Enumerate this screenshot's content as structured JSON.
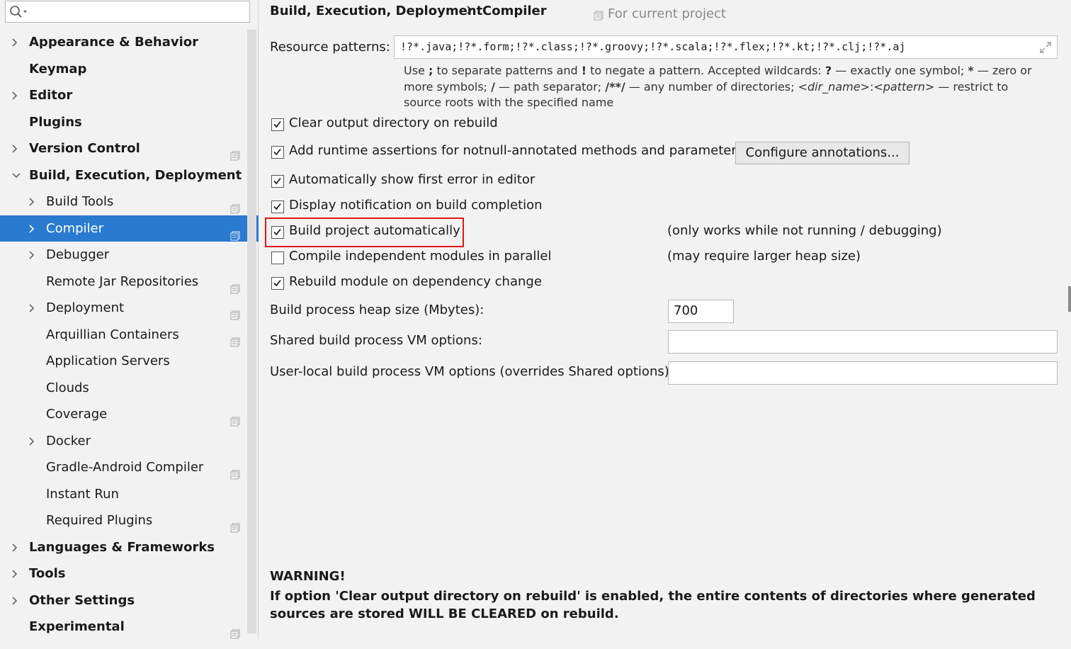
{
  "search": {
    "placeholder": ""
  },
  "sidebar": {
    "items": [
      {
        "label": "Appearance & Behavior",
        "level": 0,
        "expandable": true,
        "expanded": false,
        "project_icon": false
      },
      {
        "label": "Keymap",
        "level": 0,
        "expandable": false,
        "project_icon": false
      },
      {
        "label": "Editor",
        "level": 0,
        "expandable": true,
        "expanded": false,
        "project_icon": false
      },
      {
        "label": "Plugins",
        "level": 0,
        "expandable": false,
        "project_icon": false
      },
      {
        "label": "Version Control",
        "level": 0,
        "expandable": true,
        "expanded": false,
        "project_icon": true
      },
      {
        "label": "Build, Execution, Deployment",
        "level": 0,
        "expandable": true,
        "expanded": true,
        "project_icon": false
      },
      {
        "label": "Build Tools",
        "level": 1,
        "expandable": true,
        "expanded": false,
        "project_icon": true
      },
      {
        "label": "Compiler",
        "level": 1,
        "expandable": true,
        "expanded": false,
        "project_icon": true,
        "selected": true
      },
      {
        "label": "Debugger",
        "level": 1,
        "expandable": true,
        "expanded": false,
        "project_icon": false
      },
      {
        "label": "Remote Jar Repositories",
        "level": 1,
        "expandable": false,
        "project_icon": true
      },
      {
        "label": "Deployment",
        "level": 1,
        "expandable": true,
        "expanded": false,
        "project_icon": true
      },
      {
        "label": "Arquillian Containers",
        "level": 1,
        "expandable": false,
        "project_icon": true
      },
      {
        "label": "Application Servers",
        "level": 1,
        "expandable": false,
        "project_icon": false
      },
      {
        "label": "Clouds",
        "level": 1,
        "expandable": false,
        "project_icon": false
      },
      {
        "label": "Coverage",
        "level": 1,
        "expandable": false,
        "project_icon": true
      },
      {
        "label": "Docker",
        "level": 1,
        "expandable": true,
        "expanded": false,
        "project_icon": false
      },
      {
        "label": "Gradle-Android Compiler",
        "level": 1,
        "expandable": false,
        "project_icon": true
      },
      {
        "label": "Instant Run",
        "level": 1,
        "expandable": false,
        "project_icon": false
      },
      {
        "label": "Required Plugins",
        "level": 1,
        "expandable": false,
        "project_icon": true
      },
      {
        "label": "Languages & Frameworks",
        "level": 0,
        "expandable": true,
        "expanded": false,
        "project_icon": false
      },
      {
        "label": "Tools",
        "level": 0,
        "expandable": true,
        "expanded": false,
        "project_icon": false
      },
      {
        "label": "Other Settings",
        "level": 0,
        "expandable": true,
        "expanded": false,
        "project_icon": false
      },
      {
        "label": "Experimental",
        "level": 0,
        "expandable": false,
        "project_icon": true
      }
    ]
  },
  "header": {
    "crumb1": "Build, Execution, Deployment",
    "crumb2": "Compiler",
    "for_project": "For current project"
  },
  "resource": {
    "label": "Resource patterns:",
    "value": "!?*.java;!?*.form;!?*.class;!?*.groovy;!?*.scala;!?*.flex;!?*.kt;!?*.clj;!?*.aj",
    "hint": {
      "t1": "Use ",
      "b1": ";",
      "t2": " to separate patterns and ",
      "b2": "!",
      "t3": " to negate a pattern. Accepted wildcards: ",
      "b3": "?",
      "t4": " — exactly one symbol; ",
      "b4": "*",
      "t5": " — zero or more symbols; ",
      "b5": "/",
      "t6": " — path separator; ",
      "b6": "/**/",
      "t7": " — any number of directories; ",
      "i1": "<dir_name>",
      "t8": ":",
      "i2": "<pattern>",
      "t9": " — restrict to source roots with the specified name"
    }
  },
  "options": {
    "clear_output": {
      "label": "Clear output directory on rebuild",
      "checked": true
    },
    "runtime_assertions": {
      "label": "Add runtime assertions for notnull-annotated methods and parameters",
      "checked": true
    },
    "configure_button": "Configure annotations...",
    "show_first_error": {
      "label": "Automatically show first error in editor",
      "checked": true
    },
    "display_notification": {
      "label": "Display notification on build completion",
      "checked": true
    },
    "build_auto": {
      "label": "Build project automatically",
      "checked": true,
      "note": "(only works while not running / debugging)"
    },
    "compile_parallel": {
      "label": "Compile independent modules in parallel",
      "checked": false,
      "note": "(may require larger heap size)"
    },
    "rebuild_on_dep": {
      "label": "Rebuild module on dependency change",
      "checked": true
    }
  },
  "heap": {
    "label": "Build process heap size (Mbytes):",
    "value": "700"
  },
  "shared_vm": {
    "label": "Shared build process VM options:",
    "value": ""
  },
  "user_vm": {
    "label": "User-local build process VM options (overrides Shared options):",
    "value": ""
  },
  "warning": {
    "title": "WARNING!",
    "text": "If option 'Clear output directory on rebuild' is enabled, the entire contents of directories where generated sources are stored WILL BE CLEARED on rebuild."
  },
  "colors": {
    "selection": "#2a7bd0",
    "highlight_box": "#e0161b"
  }
}
